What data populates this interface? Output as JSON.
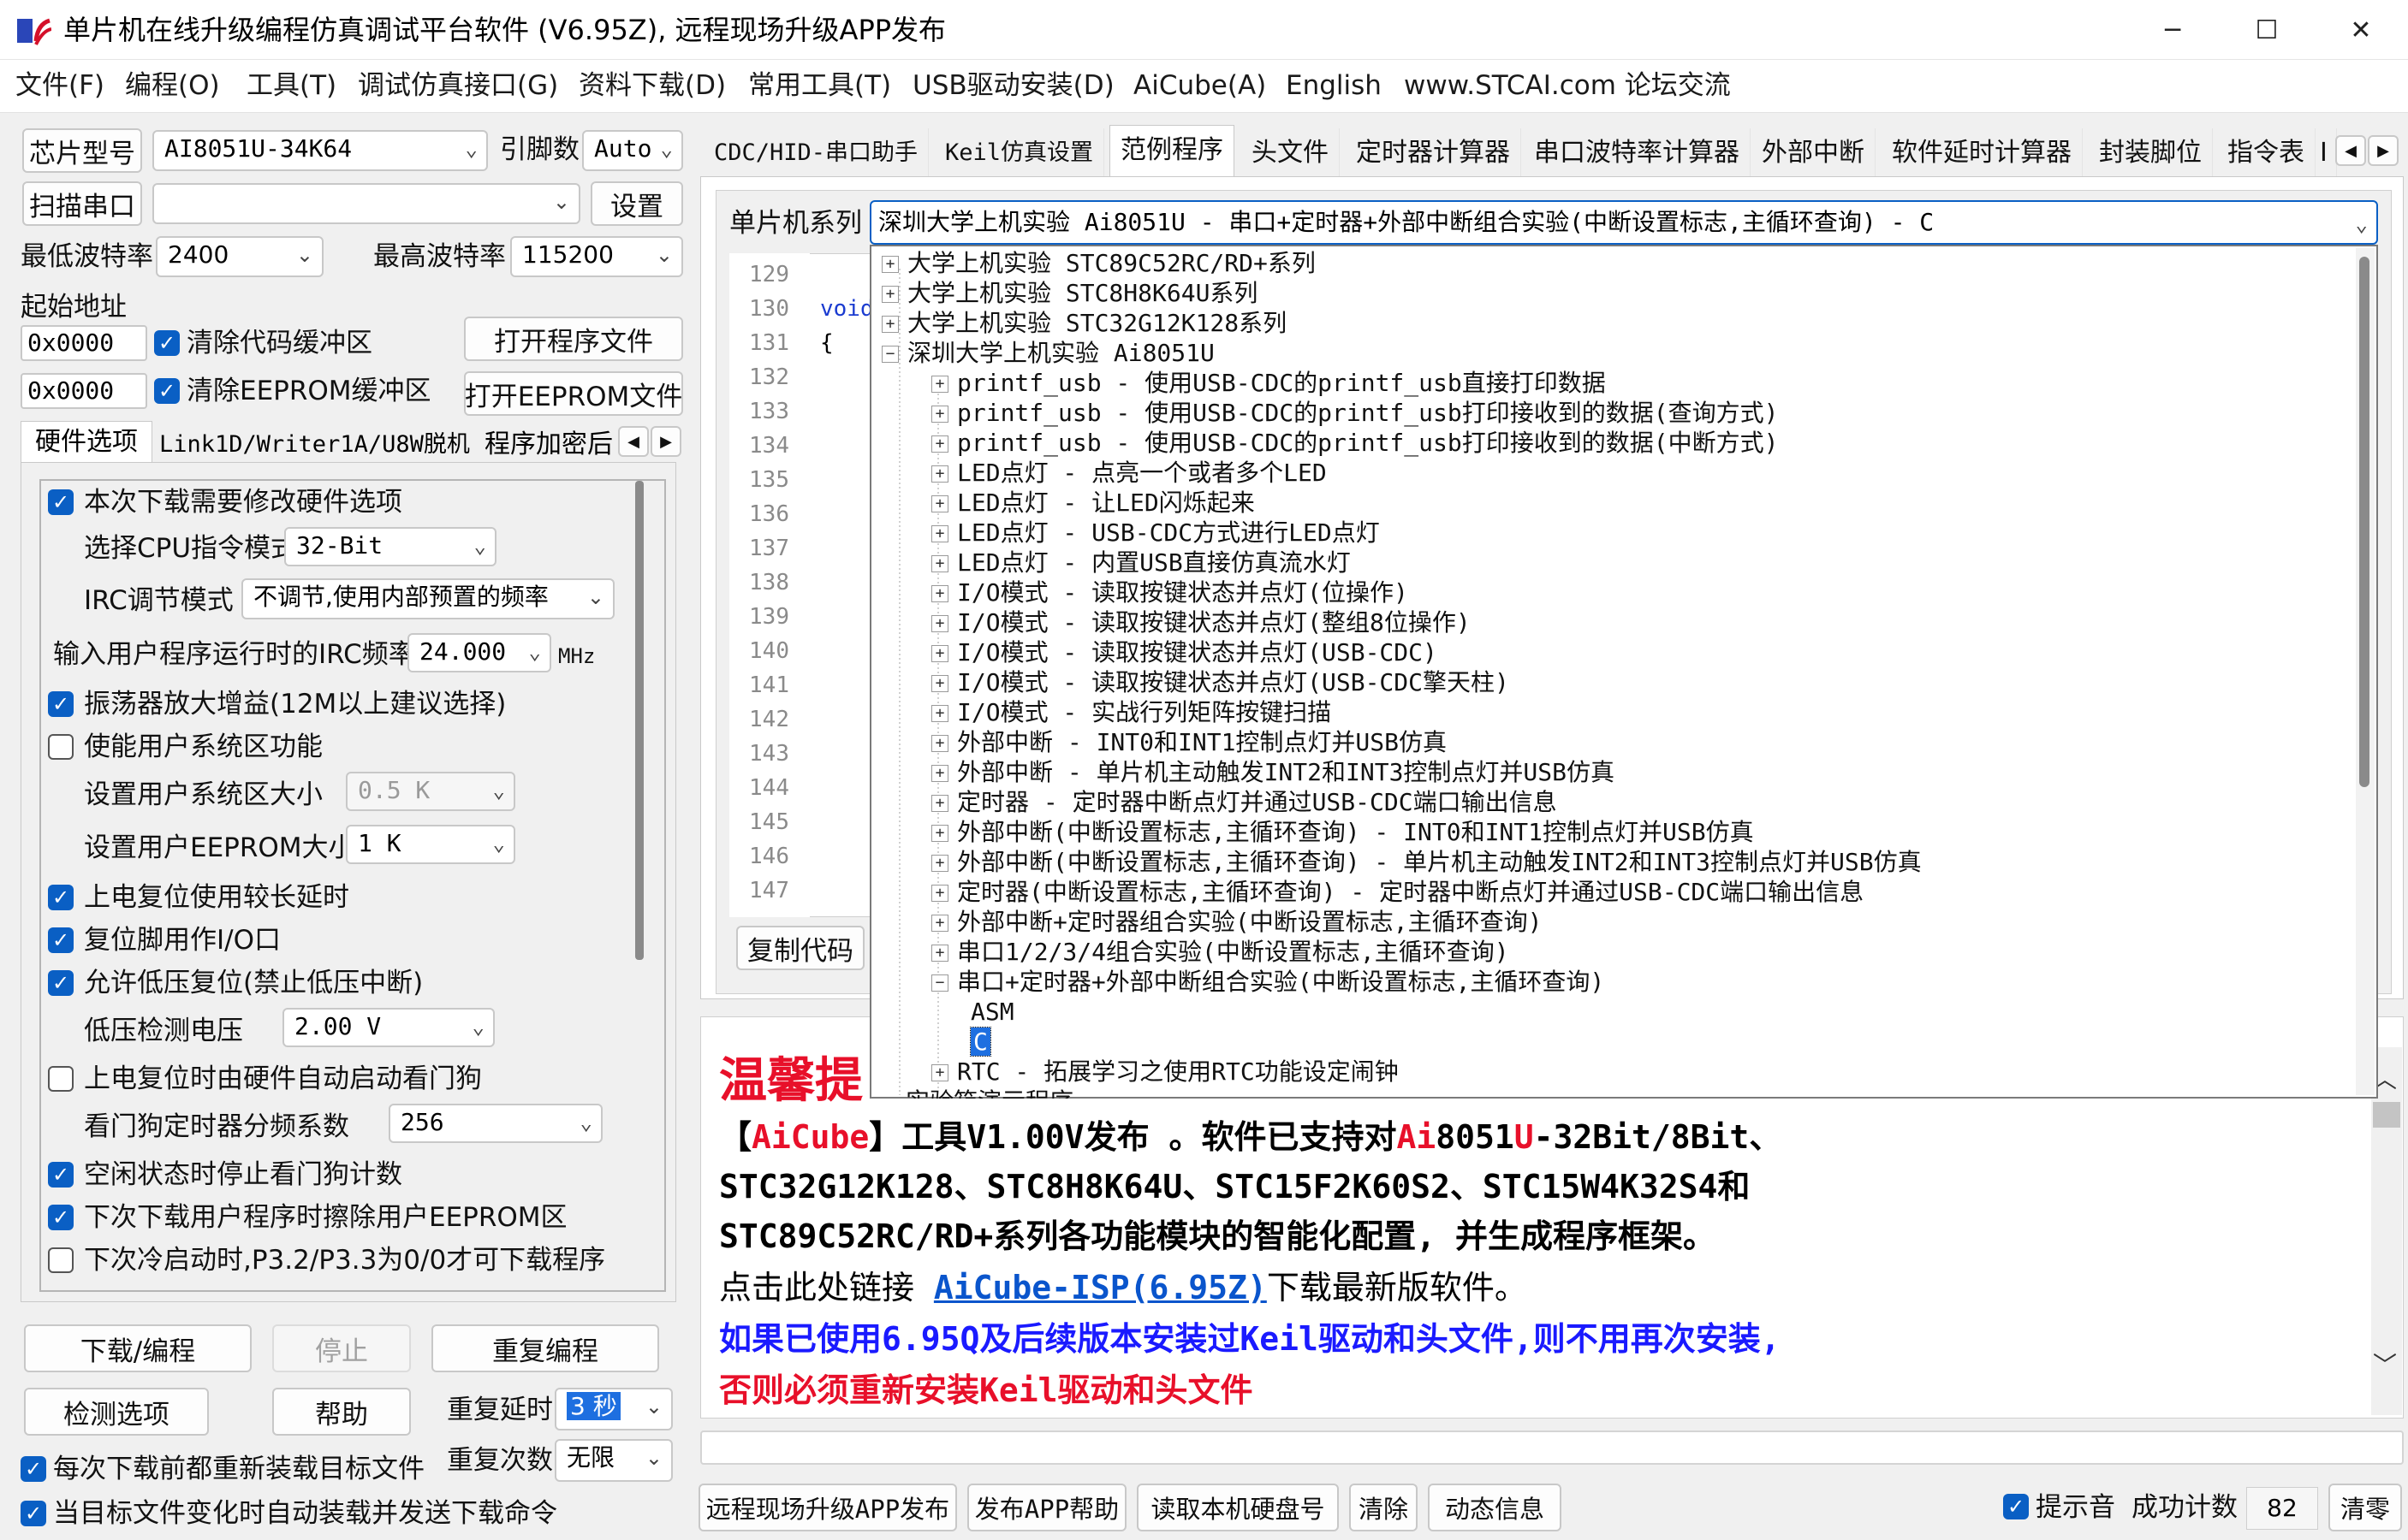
{
  "window": {
    "title": "单片机在线升级编程仿真调试平台软件 (V6.95Z), 远程现场升级APP发布",
    "minimize": "─",
    "maximize": "☐",
    "close": "✕"
  },
  "menu": [
    "文件(F)",
    "编程(O)",
    "工具(T)",
    "调试仿真接口(G)",
    "资料下载(D)",
    "常用工具(T)",
    "USB驱动安装(D)",
    "AiCube(A)",
    "English",
    "www.STCAI.com 论坛交流"
  ],
  "left": {
    "chip_btn": "芯片型号",
    "chip_value": "AI8051U-34K64",
    "pins_label": "引脚数",
    "pins_value": "Auto",
    "scan_btn": "扫描串口",
    "port_value": "",
    "settings_btn": "设置",
    "min_baud_label": "最低波特率",
    "min_baud": "2400",
    "max_baud_label": "最高波特率",
    "max_baud": "115200",
    "start_addr_label": "起始地址",
    "addr1": "0x0000",
    "clear_code": "清除代码缓冲区",
    "open_prog": "打开程序文件",
    "addr2": "0x0000",
    "clear_eeprom": "清除EEPROM缓冲区",
    "open_eeprom": "打开EEPROM文件",
    "tabs": [
      "硬件选项",
      "Link1D/Writer1A/U8W脱机",
      "程序加密后"
    ],
    "options": {
      "modify_hw": "本次下载需要修改硬件选项",
      "cpu_mode_label": "选择CPU指令模式",
      "cpu_mode": "32-Bit",
      "irc_mode_label": "IRC调节模式",
      "irc_mode": "不调节,使用内部预置的频率",
      "irc_freq_label": "输入用户程序运行时的IRC频率",
      "irc_freq": "24.000",
      "mhz": "MHz",
      "osc_gain": "振荡器放大增益(12M以上建议选择)",
      "user_sys": "使能用户系统区功能",
      "user_sys_size_label": "设置用户系统区大小",
      "user_sys_size": "0.5 K",
      "user_eeprom_label": "设置用户EEPROM大小",
      "user_eeprom": "1    K",
      "power_delay": "上电复位使用较长延时",
      "reset_io": "复位脚用作I/O口",
      "low_volt_reset": "允许低压复位(禁止低压中断)",
      "low_volt_label": "低压检测电压",
      "low_volt": "2.00 V",
      "wdt_hw": "上电复位时由硬件自动启动看门狗",
      "wdt_div_label": "看门狗定时器分频系数",
      "wdt_div": "256",
      "wdt_idle": "空闲状态时停止看门狗计数",
      "erase_eeprom": "下次下载用户程序时擦除用户EEPROM区",
      "p32p33": "下次冷启动时,P3.2/P3.3为0/0才可下载程序"
    },
    "download_btn": "下载/编程",
    "stop_btn": "停止",
    "reprogram_btn": "重复编程",
    "check_btn": "检测选项",
    "help_btn": "帮助",
    "repeat_delay_label": "重复延时",
    "repeat_delay": "3 秒",
    "repeat_count_label": "重复次数",
    "repeat_count": "无限",
    "reload_before": "每次下载前都重新装载目标文件",
    "auto_reload": "当目标文件变化时自动装载并发送下载命令"
  },
  "right": {
    "tabs": [
      "CDC/HID-串口助手",
      "Keil仿真设置",
      "范例程序",
      "头文件",
      "定时器计算器",
      "串口波特率计算器",
      "外部中断",
      "软件延时计算器",
      "封装脚位",
      "指令表",
      "I"
    ],
    "series_label": "单片机系列",
    "series_value": "深圳大学上机实验 Ai8051U - 串口+定时器+外部中断组合实验(中断设置标志,主循环查询) - C",
    "line_numbers": [
      "129",
      "130",
      "131",
      "132",
      "133",
      "134",
      "135",
      "136",
      "137",
      "138",
      "139",
      "140",
      "141",
      "142",
      "143",
      "144",
      "145",
      "146",
      "147"
    ],
    "code_line_130": "void",
    "code_line_131": "{",
    "copy_btn": "复制代码",
    "tree_top": [
      "大学上机实验 STC89C52RC/RD+系列",
      "大学上机实验 STC8H8K64U系列",
      "大学上机实验 STC32G12K128系列",
      "深圳大学上机实验 Ai8051U"
    ],
    "tree_children": [
      "printf_usb - 使用USB-CDC的printf_usb直接打印数据",
      "printf_usb - 使用USB-CDC的printf_usb打印接收到的数据(查询方式)",
      "printf_usb - 使用USB-CDC的printf_usb打印接收到的数据(中断方式)",
      "LED点灯 - 点亮一个或者多个LED",
      "LED点灯 - 让LED闪烁起来",
      "LED点灯 - USB-CDC方式进行LED点灯",
      "LED点灯 - 内置USB直接仿真流水灯",
      "I/O模式 - 读取按键状态并点灯(位操作)",
      "I/O模式 - 读取按键状态并点灯(整组8位操作)",
      "I/O模式 - 读取按键状态并点灯(USB-CDC)",
      "I/O模式 - 读取按键状态并点灯(USB-CDC擎天柱)",
      "I/O模式 - 实战行列矩阵按键扫描",
      "外部中断 - INT0和INT1控制点灯并USB仿真",
      "外部中断 - 单片机主动触发INT2和INT3控制点灯并USB仿真",
      "定时器 - 定时器中断点灯并通过USB-CDC端口输出信息",
      "外部中断(中断设置标志,主循环查询) - INT0和INT1控制点灯并USB仿真",
      "外部中断(中断设置标志,主循环查询) - 单片机主动触发INT2和INT3控制点灯并USB仿真",
      "定时器(中断设置标志,主循环查询) - 定时器中断点灯并通过USB-CDC端口输出信息",
      "外部中断+定时器组合实验(中断设置标志,主循环查询)",
      "串口1/2/3/4组合实验(中断设置标志,主循环查询)",
      "串口+定时器+外部中断组合实验(中断设置标志,主循环查询)"
    ],
    "leaf_asm": "ASM",
    "leaf_c": "C",
    "rtc_item": "RTC - 拓展学习之使用RTC功能设定闹钟",
    "cut_item": "实验箱演示程序",
    "msg_title": "温馨提",
    "msg_line1_a": "【",
    "msg_line1_b": "AiCube",
    "msg_line1_c": "】工具V1.00V发布 。软件已支持对",
    "msg_line1_d": "Ai",
    "msg_line1_e": "8051",
    "msg_line1_f": "U",
    "msg_line1_g": "-32Bit/8Bit、",
    "msg_line2": "STC32G12K128、STC8H8K64U、STC15F2K60S2、STC15W4K32S4和",
    "msg_line3": "STC89C52RC/RD+系列各功能模块的智能化配置, 并生成程序框架。",
    "msg_line4_a": "点击此处链接 ",
    "msg_line4_link": "AiCube-ISP(6.95Z)",
    "msg_line4_b": "下载最新版软件。",
    "msg_line5": "如果已使用6.95Q及后续版本安装过Keil驱动和头文件,则不用再次安装,",
    "msg_line6": "否则必须重新安装Keil驱动和头文件",
    "status_input": ""
  },
  "bottom": {
    "remote_btn": "远程现场升级APP发布",
    "app_help_btn": "发布APP帮助",
    "read_disk_btn": "读取本机硬盘号",
    "clear_btn": "清除",
    "dyn_info_btn": "动态信息",
    "notify_label": "提示音",
    "success_label": "成功计数",
    "success_count": "82",
    "reset_count_btn": "清零"
  },
  "colors": {
    "accent": "#0a5fc4",
    "red": "#e8102a",
    "blue_text": "#1a1aff",
    "link": "#0a55cc"
  }
}
